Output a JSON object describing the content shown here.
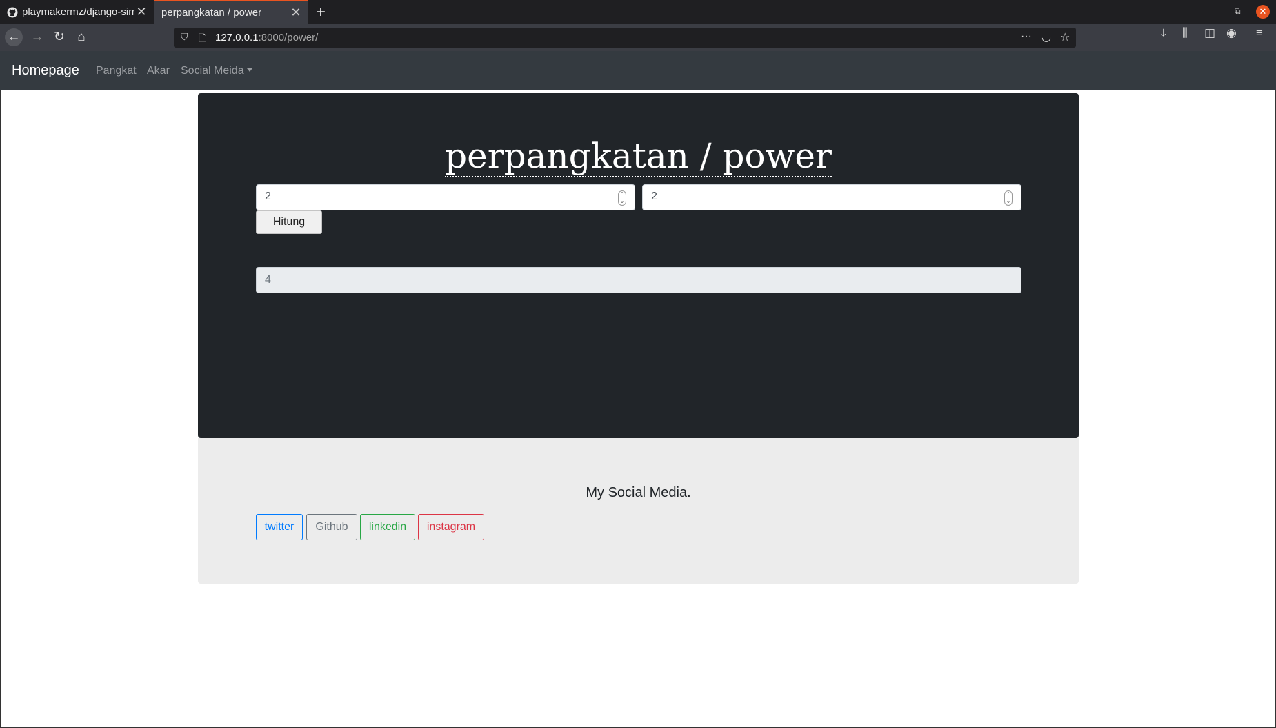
{
  "browser": {
    "tabs": [
      {
        "title": "playmakermz/django-sim",
        "active": false,
        "icon": "github-icon"
      },
      {
        "title": "perpangkatan / power",
        "active": true
      }
    ],
    "url_host": "127.0.0.1",
    "url_rest": ":8000/power/",
    "accent": "#e95420"
  },
  "nav": {
    "brand": "Homepage",
    "links": [
      "Pangkat",
      "Akar",
      "Social Meida"
    ]
  },
  "main": {
    "title": "perpangkatan / power",
    "input_base": "2",
    "input_exponent": "2",
    "button_label": "Hitung",
    "result": "4"
  },
  "social": {
    "title": "My Social Media.",
    "buttons": [
      "twitter",
      "Github",
      "linkedin",
      "instagram"
    ]
  }
}
